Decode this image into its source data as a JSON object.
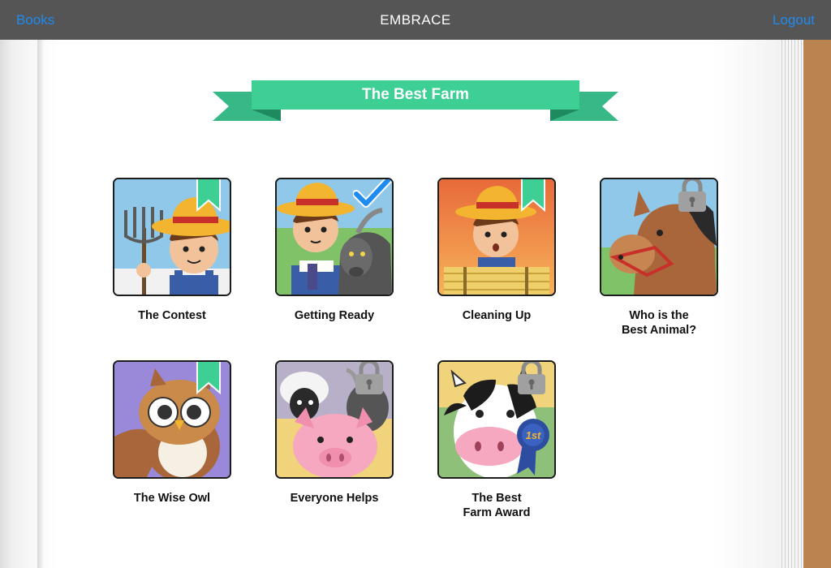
{
  "topbar": {
    "left_label": "Books",
    "title": "EMBRACE",
    "right_label": "Logout"
  },
  "banner": {
    "title": "The Best Farm"
  },
  "colors": {
    "accent": "#3ecf95",
    "link": "#1e8bf0",
    "topbar": "#555555"
  },
  "chapters": [
    {
      "title": "The Contest",
      "status": "bookmarked",
      "icon": "farmer-pitchfork-icon"
    },
    {
      "title": "Getting Ready",
      "status": "completed",
      "icon": "farmer-goat-icon"
    },
    {
      "title": "Cleaning Up",
      "status": "bookmarked",
      "icon": "farmer-hay-icon"
    },
    {
      "title": "Who is the\nBest Animal?",
      "status": "locked",
      "icon": "horse-icon"
    },
    {
      "title": "The Wise Owl",
      "status": "bookmarked",
      "icon": "owl-icon"
    },
    {
      "title": "Everyone Helps",
      "status": "locked",
      "icon": "pig-sheep-goat-icon"
    },
    {
      "title": "The Best\nFarm Award",
      "status": "locked",
      "icon": "cow-ribbon-icon"
    }
  ],
  "award": {
    "ribbon_text": "1st"
  }
}
